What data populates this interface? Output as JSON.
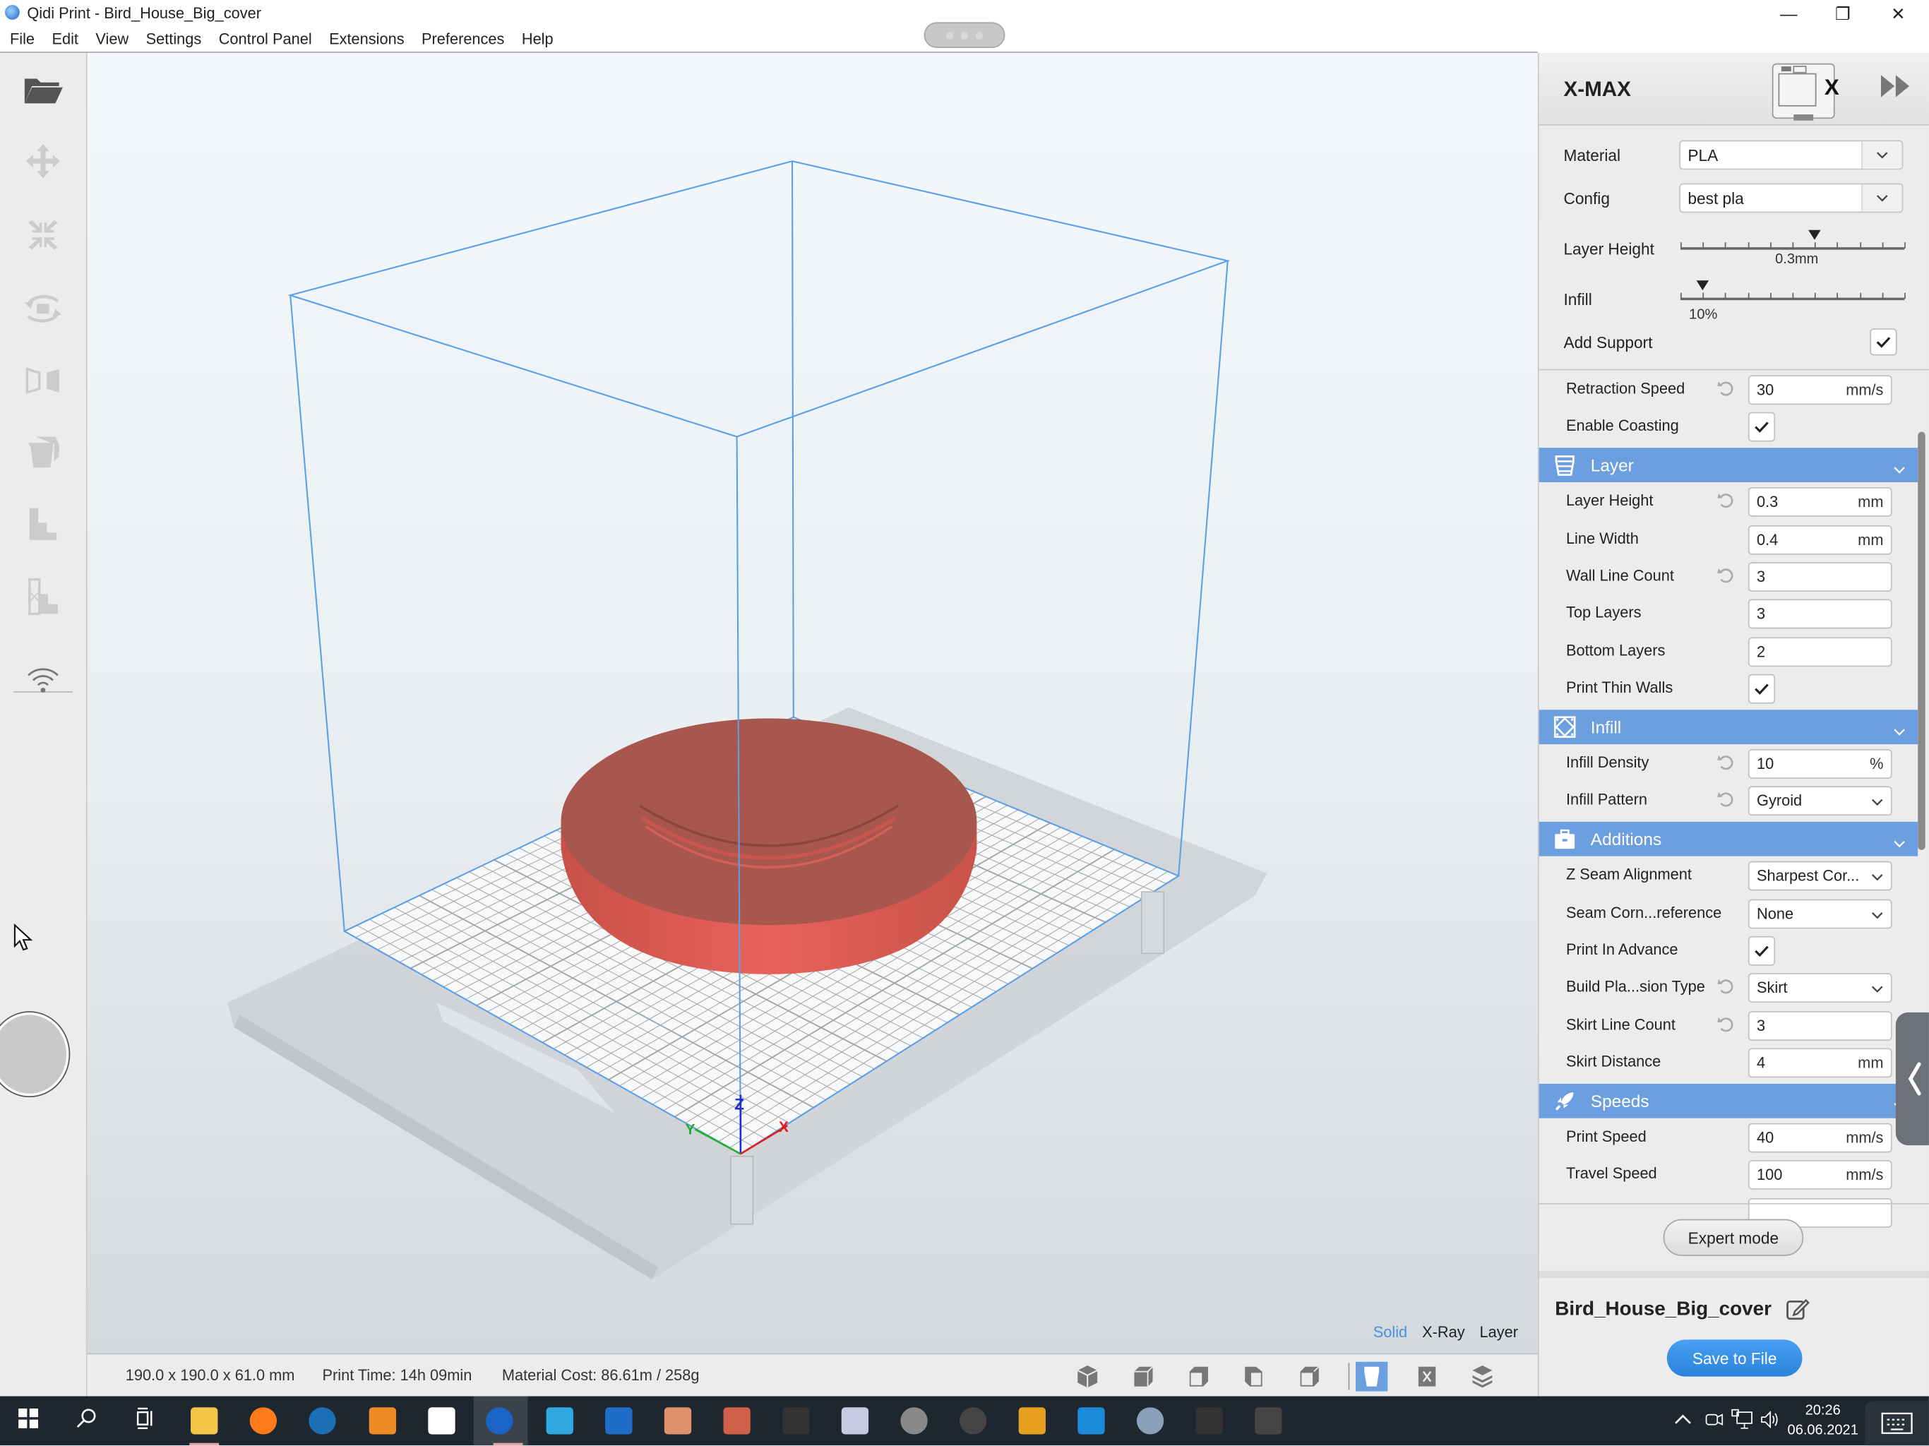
{
  "window": {
    "title": "Qidi Print - Bird_House_Big_cover",
    "controls": {
      "minimize": "—",
      "restore": "❐",
      "close": "✕"
    }
  },
  "menu": [
    "File",
    "Edit",
    "View",
    "Settings",
    "Control Panel",
    "Extensions",
    "Preferences",
    "Help"
  ],
  "left_toolbar": [
    {
      "name": "open-file",
      "icon": "folder-open-icon",
      "enabled": true
    },
    {
      "name": "move",
      "icon": "move-arrows-icon",
      "enabled": false
    },
    {
      "name": "scale",
      "icon": "scale-arrows-icon",
      "enabled": false
    },
    {
      "name": "rotate",
      "icon": "rotate-icon",
      "enabled": false
    },
    {
      "name": "mirror",
      "icon": "mirror-icon",
      "enabled": false
    },
    {
      "name": "support",
      "icon": "support-icon",
      "enabled": false
    },
    {
      "name": "per-model-settings",
      "icon": "steps-icon",
      "enabled": false
    },
    {
      "name": "support-blocker",
      "icon": "steps-blocker-icon",
      "enabled": false
    },
    {
      "name": "wifi",
      "icon": "wifi-icon",
      "enabled": true
    }
  ],
  "viewport": {
    "model_color": "#e0605a",
    "volume_color": "#5aa0e8",
    "view_modes": [
      {
        "label": "Solid",
        "active": true
      },
      {
        "label": "X-Ray",
        "active": false
      },
      {
        "label": "Layer",
        "active": false
      }
    ],
    "axes": {
      "x": "X",
      "y": "Y",
      "z": "Z"
    }
  },
  "status": {
    "dimensions": "190.0 x 190.0 x 61.0 mm",
    "print_time": "Print Time: 14h 09min",
    "material_cost": "Material Cost: 86.61m / 258g"
  },
  "view_toolbar": [
    {
      "name": "3d-view",
      "icon": "cube-3d-icon"
    },
    {
      "name": "front-view",
      "icon": "cube-front-icon"
    },
    {
      "name": "top-view",
      "icon": "cube-top-icon"
    },
    {
      "name": "left-view",
      "icon": "cube-left-icon"
    },
    {
      "name": "right-view",
      "icon": "cube-right-icon"
    },
    {
      "name": "solid-mode",
      "icon": "cup-solid-icon",
      "active": true
    },
    {
      "name": "xray-mode",
      "icon": "xray-icon"
    },
    {
      "name": "layer-mode",
      "icon": "layers-icon"
    }
  ],
  "panel": {
    "printer": "X-MAX",
    "printer_badge": "X",
    "material_label": "Material",
    "material_value": "PLA",
    "config_label": "Config",
    "config_value": "best pla",
    "layer_height_label": "Layer Height",
    "layer_height_value": "0.3mm",
    "layer_height_fraction": 0.6,
    "infill_label": "Infill",
    "infill_value": "10%",
    "infill_fraction": 0.1,
    "add_support_label": "Add Support",
    "add_support_checked": true,
    "accent_color": "#6b9fdf",
    "pre_rows": [
      {
        "label": "Retraction Speed",
        "value": "30",
        "unit": "mm/s",
        "reset": true,
        "type": "input"
      },
      {
        "label": "Enable Coasting",
        "checked": true,
        "type": "checkbox"
      }
    ],
    "sections": [
      {
        "title": "Layer",
        "icon": "layer-cup-icon",
        "rows": [
          {
            "label": "Layer Height",
            "value": "0.3",
            "unit": "mm",
            "reset": true,
            "type": "input"
          },
          {
            "label": "Line Width",
            "value": "0.4",
            "unit": "mm",
            "reset": false,
            "type": "input"
          },
          {
            "label": "Wall Line Count",
            "value": "3",
            "unit": "",
            "reset": true,
            "type": "input"
          },
          {
            "label": "Top Layers",
            "value": "3",
            "unit": "",
            "reset": false,
            "type": "input"
          },
          {
            "label": "Bottom Layers",
            "value": "2",
            "unit": "",
            "reset": false,
            "type": "input"
          },
          {
            "label": "Print Thin Walls",
            "checked": true,
            "type": "checkbox"
          }
        ]
      },
      {
        "title": "Infill",
        "icon": "infill-pattern-icon",
        "rows": [
          {
            "label": "Infill Density",
            "value": "10",
            "unit": "%",
            "reset": true,
            "type": "input"
          },
          {
            "label": "Infill Pattern",
            "value": "Gyroid",
            "reset": true,
            "type": "select"
          }
        ]
      },
      {
        "title": "Additions",
        "icon": "toolbox-icon",
        "rows": [
          {
            "label": "Z Seam Alignment",
            "value": "Sharpest Cor...",
            "reset": false,
            "type": "select"
          },
          {
            "label": "Seam Corn...reference",
            "value": "None",
            "reset": false,
            "type": "select"
          },
          {
            "label": "Print In Advance",
            "checked": true,
            "type": "checkbox"
          },
          {
            "label": "Build Pla...sion Type",
            "value": "Skirt",
            "reset": true,
            "type": "select"
          },
          {
            "label": "Skirt Line Count",
            "value": "3",
            "unit": "",
            "reset": true,
            "type": "input"
          },
          {
            "label": "Skirt Distance",
            "value": "4",
            "unit": "mm",
            "reset": false,
            "type": "input"
          }
        ]
      },
      {
        "title": "Speeds",
        "icon": "rocket-icon",
        "rows": [
          {
            "label": "Print Speed",
            "value": "40",
            "unit": "mm/s",
            "reset": false,
            "type": "input"
          },
          {
            "label": "Travel Speed",
            "value": "100",
            "unit": "mm/s",
            "reset": false,
            "type": "input"
          }
        ]
      }
    ],
    "expert_button": "Expert mode",
    "file_name": "Bird_House_Big_cover",
    "save_button": "Save to File"
  },
  "taskbar": {
    "apps": [
      {
        "name": "start",
        "icon": "windows-logo-icon"
      },
      {
        "name": "search",
        "icon": "search-icon"
      },
      {
        "name": "task-view",
        "icon": "task-view-icon"
      },
      {
        "name": "file-explorer",
        "icon": "folder-icon",
        "color": "#f3c64a"
      },
      {
        "name": "firefox",
        "icon": "firefox-icon",
        "color": "#ff7a1a"
      },
      {
        "name": "steam",
        "icon": "steam-icon",
        "color": "#1b6fb5"
      },
      {
        "name": "blender",
        "icon": "blender-icon",
        "color": "#f08a24"
      },
      {
        "name": "xmind",
        "icon": "x-app-icon",
        "color": "#ffffff"
      },
      {
        "name": "qidi-print",
        "icon": "qidi-print-icon",
        "color": "#1a64c8",
        "active": true
      },
      {
        "name": "video-editor",
        "icon": "film-icon",
        "color": "#31a8e0"
      },
      {
        "name": "powershell",
        "icon": "powershell-icon",
        "color": "#1e6ec8"
      },
      {
        "name": "face-app",
        "icon": "face-icon",
        "color": "#e0906a"
      },
      {
        "name": "polyhedron-app",
        "icon": "polyhedron-icon",
        "color": "#d0604a"
      },
      {
        "name": "makerbot",
        "icon": "makerbot-icon",
        "color": "#333333"
      },
      {
        "name": "monitor-app",
        "icon": "monitor-app-icon",
        "color": "#c8c8e0"
      },
      {
        "name": "vr-app",
        "icon": "vr-icon",
        "color": "#888888"
      },
      {
        "name": "figure-app",
        "icon": "figure-icon",
        "color": "#444444"
      },
      {
        "name": "flash-app",
        "icon": "fs-icon",
        "color": "#e8a020"
      },
      {
        "name": "cross-app",
        "icon": "cross-shape-icon",
        "color": "#1a8ad8"
      },
      {
        "name": "aperture-app",
        "icon": "aperture-icon",
        "color": "#8aa0b8"
      },
      {
        "name": "inkscape",
        "icon": "inkscape-icon",
        "color": "#333333"
      },
      {
        "name": "curve-app",
        "icon": "curve-icon",
        "color": "#444444"
      }
    ],
    "time": "20:26",
    "date": "06.06.2021"
  }
}
